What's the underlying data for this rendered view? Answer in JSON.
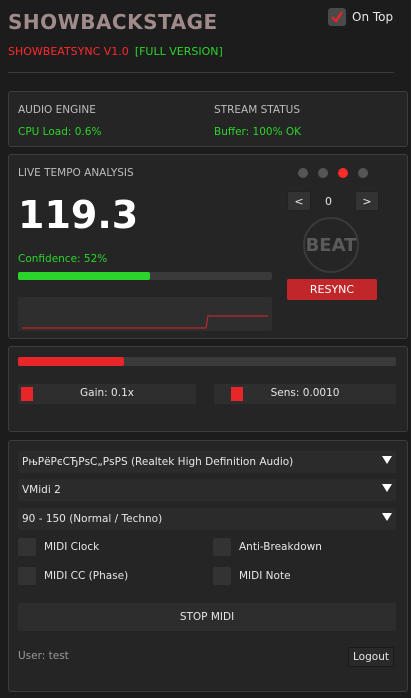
{
  "app": {
    "title": "SHOWBACKSTAGE",
    "version": "SHOWBEATSYNC V1.0",
    "edition": "[FULL VERSION]",
    "on_top_label": "On Top",
    "on_top_checked": true
  },
  "status": {
    "audio_engine_label": "AUDIO ENGINE",
    "cpu_text": "CPU Load: 0.6%",
    "stream_status_label": "STREAM STATUS",
    "buffer_text": "Buffer: 100% OK"
  },
  "tempo": {
    "section_label": "LIVE TEMPO ANALYSIS",
    "bpm": "119.3",
    "confidence_text": "Confidence: 52%",
    "confidence_fraction": 0.52,
    "beat_dots": [
      false,
      false,
      true,
      false
    ],
    "prev_label": "<",
    "next_label": ">",
    "offset_value": "0",
    "beat_label": "BEAT",
    "resync_label": "RESYNC",
    "accent_color": "#ff2a2a",
    "confidence_color": "#2bd42b"
  },
  "levels": {
    "input_level_fraction": 0.28,
    "gain_text": "Gain: 0.1x",
    "sens_text": "Sens: 0.0010"
  },
  "midi": {
    "audio_device": "РњРёРєСЂРѕС„РѕРЅ (Realtek High Definition Audio)",
    "midi_port": "VMidi 2",
    "bpm_range": "90 - 150 (Normal / Techno)",
    "options": [
      {
        "label": "MIDI Clock",
        "checked": false
      },
      {
        "label": "Anti-Breakdown",
        "checked": false
      },
      {
        "label": "MIDI CC (Phase)",
        "checked": false
      },
      {
        "label": "MIDI Note",
        "checked": false
      }
    ],
    "stop_label": "STOP MIDI"
  },
  "footer": {
    "user_text": "User: test",
    "logout_label": "Logout"
  }
}
